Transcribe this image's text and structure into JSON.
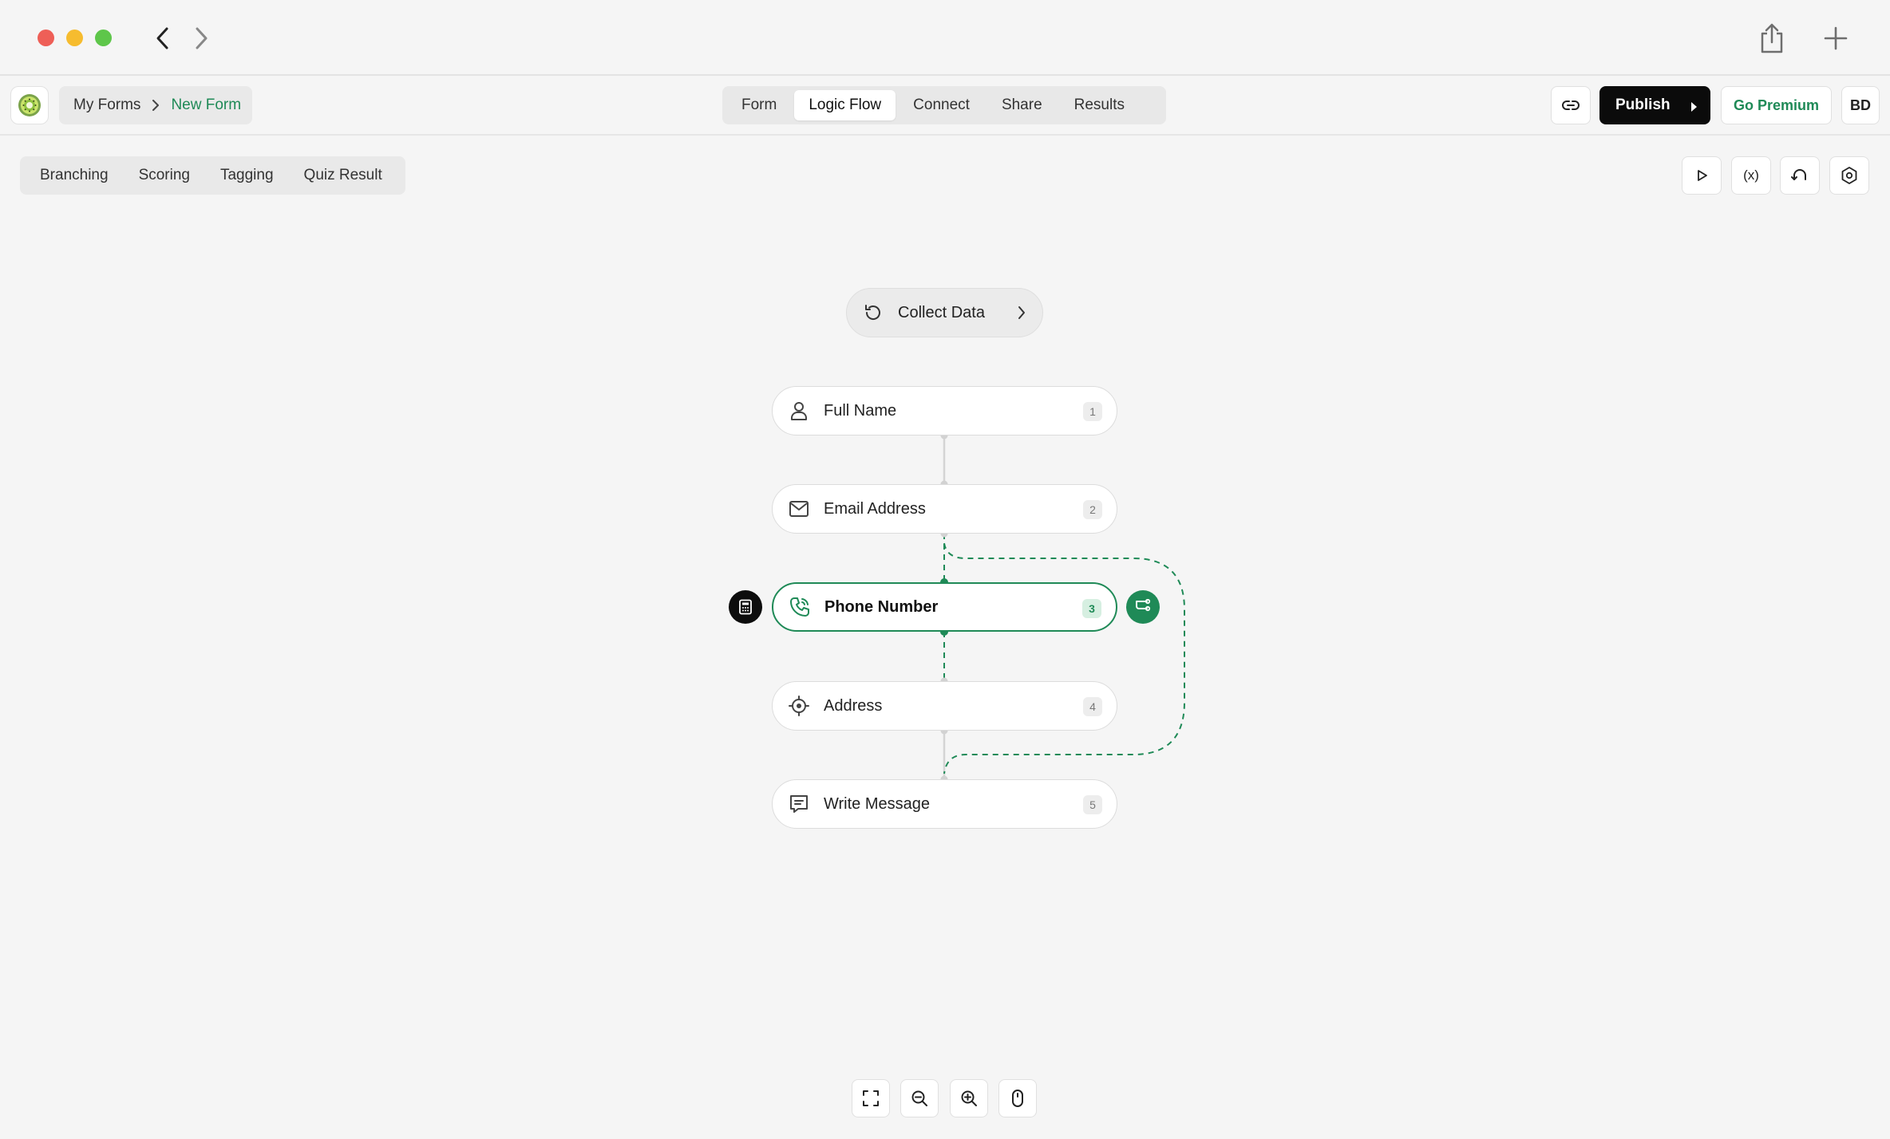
{
  "breadcrumb": {
    "root": "My Forms",
    "current": "New Form"
  },
  "main_tabs": [
    {
      "label": "Form"
    },
    {
      "label": "Logic Flow"
    },
    {
      "label": "Connect"
    },
    {
      "label": "Share"
    },
    {
      "label": "Results"
    }
  ],
  "main_tabs_active": "Logic Flow",
  "header": {
    "publish_label": "Publish",
    "premium_label": "Go Premium",
    "avatar_initials": "BD"
  },
  "sub_tabs": [
    {
      "label": "Branching"
    },
    {
      "label": "Scoring"
    },
    {
      "label": "Tagging"
    },
    {
      "label": "Quiz Result"
    }
  ],
  "toolbar": {
    "variables_label": "(x)"
  },
  "flow": {
    "start_label": "Collect Data",
    "nodes": [
      {
        "label": "Full Name",
        "number": "1",
        "icon": "person-icon"
      },
      {
        "label": "Email Address",
        "number": "2",
        "icon": "envelope-icon"
      },
      {
        "label": "Phone Number",
        "number": "3",
        "icon": "phone-icon",
        "selected": true
      },
      {
        "label": "Address",
        "number": "4",
        "icon": "location-icon"
      },
      {
        "label": "Write Message",
        "number": "5",
        "icon": "message-icon"
      }
    ]
  },
  "colors": {
    "accent": "#1f8a57",
    "publish_bg": "#0b0b0b",
    "traffic_red": "#ee5f57",
    "traffic_yellow": "#f6bc2f",
    "traffic_green": "#5ec64a"
  }
}
